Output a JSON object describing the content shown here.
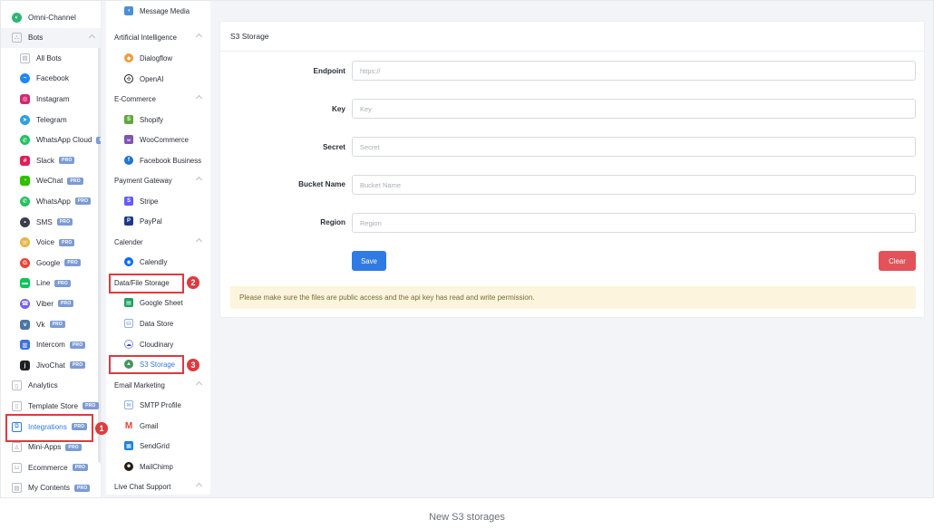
{
  "sidebar": {
    "items": [
      {
        "label": "Omni-Channel",
        "icon": "omni-channel-icon",
        "color": "#2bb673",
        "glyph": "◐",
        "pro": false
      },
      {
        "label": "Bots",
        "icon": "bots-icon",
        "color": "#b0b5bf",
        "glyph": "⛬",
        "pro": false
      },
      {
        "label": "All Bots",
        "icon": "all-bots-icon",
        "color": "#b0b5bf",
        "glyph": "▤",
        "pro": false
      },
      {
        "label": "Facebook",
        "icon": "messenger-icon",
        "color": "#1e88f5",
        "glyph": "~",
        "pro": false
      },
      {
        "label": "Instagram",
        "icon": "instagram-icon",
        "color": "#d6286e",
        "glyph": "◎",
        "pro": false
      },
      {
        "label": "Telegram",
        "icon": "telegram-icon",
        "color": "#2aa3dc",
        "glyph": "➤",
        "pro": false
      },
      {
        "label": "WhatsApp Cloud",
        "icon": "whatsapp-cloud-icon",
        "color": "#25c160",
        "glyph": "✆",
        "pro": true
      },
      {
        "label": "Slack",
        "icon": "slack-icon",
        "color": "#e01e5a",
        "glyph": "#",
        "pro": true
      },
      {
        "label": "WeChat",
        "icon": "wechat-icon",
        "color": "#2dc100",
        "glyph": "◔",
        "pro": true
      },
      {
        "label": "WhatsApp",
        "icon": "whatsapp-icon",
        "color": "#25c160",
        "glyph": "✆",
        "pro": true
      },
      {
        "label": "SMS",
        "icon": "sms-icon",
        "color": "#3a3f4a",
        "glyph": "•",
        "pro": true
      },
      {
        "label": "Voice",
        "icon": "voice-icon",
        "color": "#e8b341",
        "glyph": "☏",
        "pro": true
      },
      {
        "label": "Google",
        "icon": "google-icon",
        "color": "#ea4335",
        "glyph": "G",
        "pro": true
      },
      {
        "label": "Line",
        "icon": "line-icon",
        "color": "#06c755",
        "glyph": "▬",
        "pro": true
      },
      {
        "label": "Viber",
        "icon": "viber-icon",
        "color": "#7360f2",
        "glyph": "☎",
        "pro": true
      },
      {
        "label": "Vk",
        "icon": "vk-icon",
        "color": "#4c75a3",
        "glyph": "v",
        "pro": true
      },
      {
        "label": "Intercom",
        "icon": "intercom-icon",
        "color": "#3d6fe0",
        "glyph": "▥",
        "pro": true
      },
      {
        "label": "JivoChat",
        "icon": "jivochat-icon",
        "color": "#1c2024",
        "glyph": "j",
        "pro": true
      },
      {
        "label": "Analytics",
        "icon": "analytics-icon",
        "color": "#b0b5bf",
        "glyph": "▯",
        "pro": false
      },
      {
        "label": "Template Store",
        "icon": "template-store-icon",
        "color": "#b0b5bf",
        "glyph": "▯",
        "pro": true
      },
      {
        "label": "Integrations",
        "icon": "integrations-icon",
        "color": "#2f7ae5",
        "glyph": "⧉",
        "pro": true
      },
      {
        "label": "Mini-Apps",
        "icon": "mini-apps-icon",
        "color": "#b0b5bf",
        "glyph": "♙",
        "pro": true
      },
      {
        "label": "Ecommerce",
        "icon": "ecommerce-icon",
        "color": "#b0b5bf",
        "glyph": "⊔",
        "pro": true
      },
      {
        "label": "My Contents",
        "icon": "my-contents-icon",
        "color": "#b0b5bf",
        "glyph": "▤",
        "pro": true
      }
    ],
    "pro_label": "PRO"
  },
  "integrations_menu": {
    "message_media": "Message Media",
    "sections": {
      "ai": "Artificial Intelligence",
      "ecommerce": "E-Commerce",
      "payment": "Payment Gateway",
      "calender": "Calender",
      "storage": "Data/File Storage",
      "email": "Email Marketing",
      "livechat": "Live Chat Support"
    },
    "items": {
      "dialogflow": "Dialogflow",
      "openai": "OpenAI",
      "shopify": "Shopify",
      "woocommerce": "WooCommerce",
      "facebook_business": "Facebook Business",
      "stripe": "Stripe",
      "paypal": "PayPal",
      "calendly": "Calendly",
      "google_sheet": "Google Sheet",
      "data_store": "Data Store",
      "cloudinary": "Cloudinary",
      "s3_storage": "S3 Storage",
      "smtp_profile": "SMTP Profile",
      "gmail": "Gmail",
      "sendgrid": "SendGrid",
      "mailchimp": "MailChimp"
    }
  },
  "callouts": {
    "one": "1",
    "two": "2",
    "three": "3"
  },
  "panel": {
    "title": "S3 Storage",
    "fields": {
      "endpoint": {
        "label": "Endpoint",
        "placeholder": "https://",
        "value": ""
      },
      "key": {
        "label": "Key",
        "placeholder": "Key",
        "value": ""
      },
      "secret": {
        "label": "Secret",
        "placeholder": "Secret",
        "value": ""
      },
      "bucket": {
        "label": "Bucket Name",
        "placeholder": "Bucket Name",
        "value": ""
      },
      "region": {
        "label": "Region",
        "placeholder": "Region",
        "value": ""
      }
    },
    "save_label": "Save",
    "clear_label": "Clear",
    "notice": "Please make sure the files are public access and the api key has read and write permission."
  },
  "caption": "New S3 storages",
  "colors": {
    "accent": "#2f7ae5",
    "danger": "#e25258",
    "callout": "#e0393e",
    "notice_bg": "#fcf4dc"
  }
}
